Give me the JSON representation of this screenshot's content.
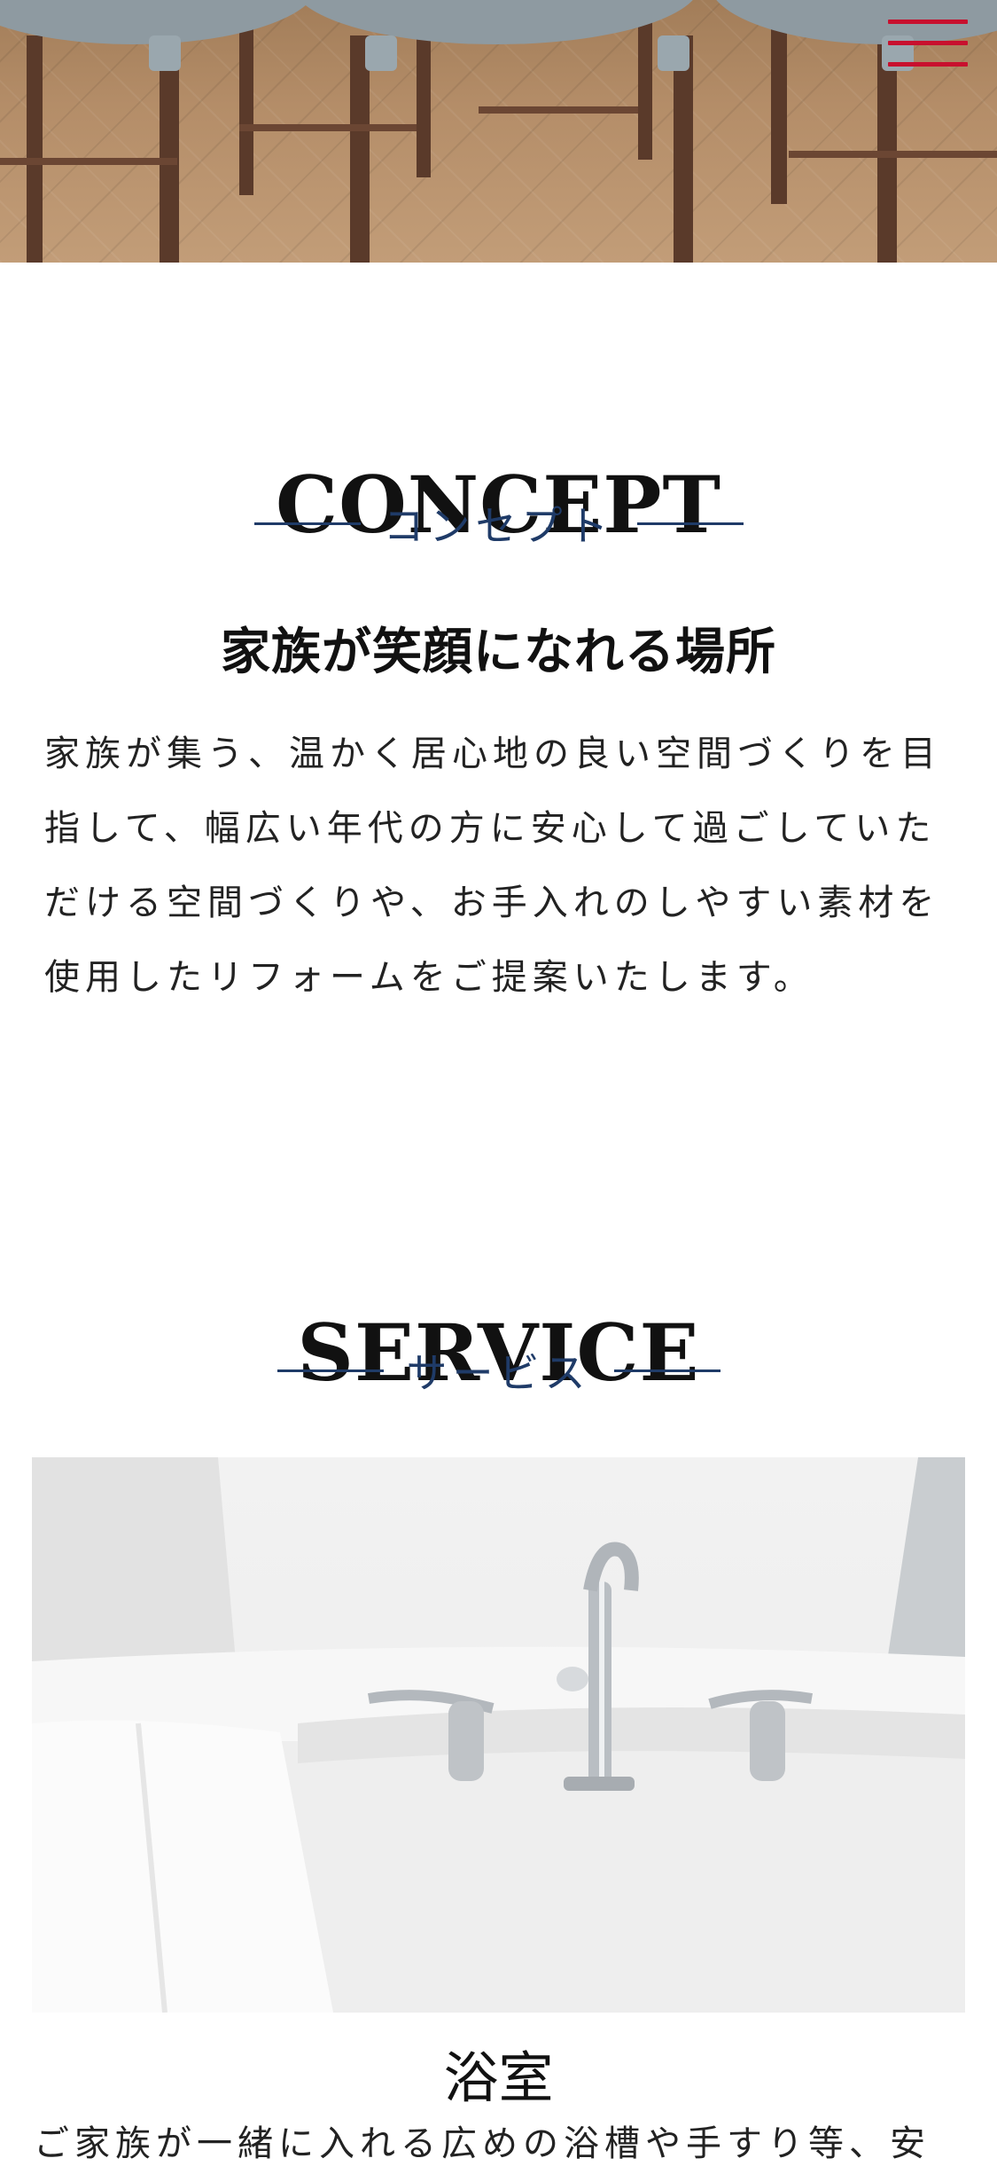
{
  "header": {
    "menu_icon": "hamburger-menu-icon",
    "menu_color": "#c8102e"
  },
  "concept": {
    "title": "CONCEPT",
    "subtitle": "コンセプト",
    "catch": "家族が笑顔になれる場所",
    "lines": [
      "家族が集う、温かく居心地の良い空間づくりを目",
      "指して、幅広い年代の方に安心して過ごしていた",
      "だける空間づくりや、お手入れのしやすい素材を",
      "使用したリフォームをご提案いたします。"
    ]
  },
  "service": {
    "title": "SERVICE",
    "subtitle": "サービス",
    "items": [
      {
        "name": "浴室",
        "description": "ご家族が一緒に入れる広めの浴槽や手すり等、安"
      }
    ]
  },
  "colors": {
    "accent": "#1f3b68",
    "title_text": "#111111"
  }
}
